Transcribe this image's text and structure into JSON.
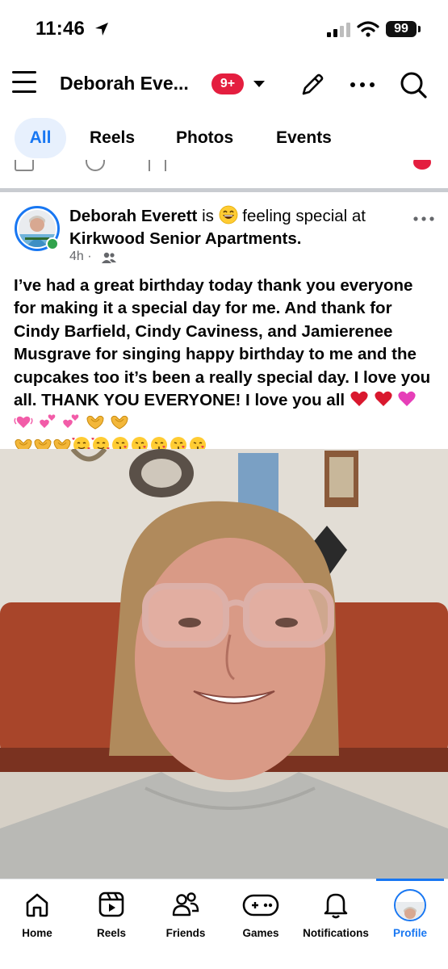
{
  "status_bar": {
    "time": "11:46",
    "battery": "99"
  },
  "header": {
    "title": "Deborah Eve...",
    "badge": "9+"
  },
  "tabs": [
    {
      "label": "All",
      "active": true
    },
    {
      "label": "Reels",
      "active": false
    },
    {
      "label": "Photos",
      "active": false
    },
    {
      "label": "Events",
      "active": false
    }
  ],
  "post": {
    "author": "Deborah Everett",
    "verb": "is",
    "feeling": "feeling special at",
    "place": "Kirkwood Senior Apartments",
    "time": "4h",
    "separator": "·",
    "body": "I’ve had a great birthday today thank you everyone for making it a special day for me. And thank for Cindy Barfield, Cindy Caviness, and Jamierenee Musgrave for singing happy birthday to me and the cupcakes too it’s been a really special day. I love you all. THANK YOU EVERYONE! I love you all"
  },
  "bottom_nav": [
    {
      "label": "Home",
      "icon": "home-icon"
    },
    {
      "label": "Reels",
      "icon": "reels-icon"
    },
    {
      "label": "Friends",
      "icon": "friends-icon"
    },
    {
      "label": "Games",
      "icon": "games-icon"
    },
    {
      "label": "Notifications",
      "icon": "bell-icon"
    },
    {
      "label": "Profile",
      "icon": "avatar",
      "active": true
    }
  ],
  "colors": {
    "accent": "#1877f2",
    "badge": "#e41e3f",
    "online": "#31a24c"
  }
}
